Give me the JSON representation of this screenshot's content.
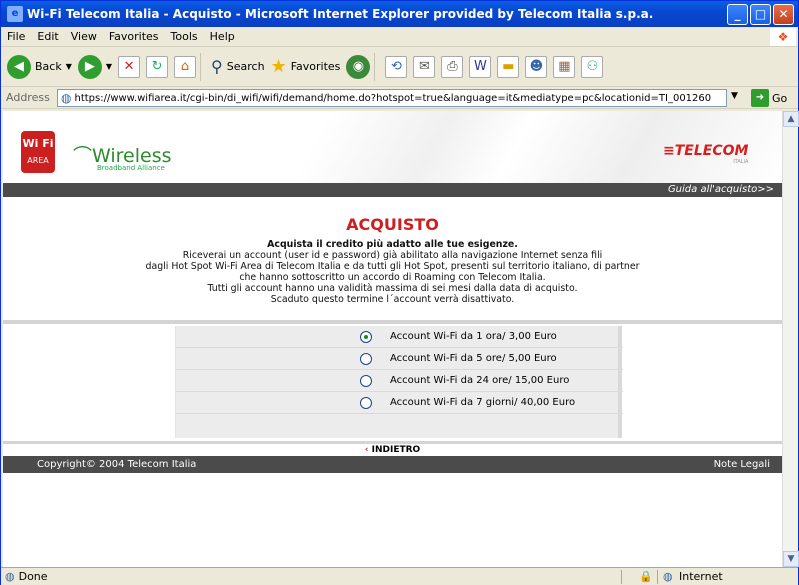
{
  "window": {
    "title": "Wi-Fi Telecom Italia - Acquisto - Microsoft Internet Explorer provided by Telecom Italia s.p.a."
  },
  "menu": [
    "File",
    "Edit",
    "View",
    "Favorites",
    "Tools",
    "Help"
  ],
  "toolbar": {
    "back": "Back",
    "search": "Search",
    "favorites": "Favorites"
  },
  "address": {
    "label": "Address",
    "url": "https://www.wifiarea.it/cgi-bin/di_wifi/wifi/demand/home.do?hotspot=true&language=it&mediatype=pc&locationid=TI_001260",
    "go": "Go"
  },
  "page": {
    "logo_wifi": "Wi Fi",
    "logo_area": "AREA",
    "wireless": "Wireless",
    "wireless_sub": "Broadband Alliance",
    "telecom": "TELECOM",
    "telecom_sub": "ITALIA",
    "guide_link": "Guida all'acquisto>>",
    "title": "ACQUISTO",
    "headline": "Acquista il credito più adatto alle tue esigenze.",
    "lines": [
      "Riceverai un account (user id e password) già abilitato alla navigazione Internet senza fili",
      "dagli Hot Spot Wi-Fi Area di Telecom Italia e da tutti gli Hot Spot, presenti sul territorio italiano, di partner",
      "che hanno sottoscritto un accordo di Roaming con Telecom Italia.",
      "Tutti gli account hanno una validità massima di sei mesi dalla data di acquisto.",
      "Scaduto questo termine l´account verrà disattivato."
    ],
    "options": [
      {
        "label": "Account Wi-Fi da 1 ora/ 3,00 Euro",
        "selected": true
      },
      {
        "label": "Account Wi-Fi da 5 ore/ 5,00 Euro",
        "selected": false
      },
      {
        "label": "Account Wi-Fi da 24 ore/ 15,00 Euro",
        "selected": false
      },
      {
        "label": "Account Wi-Fi da 7 giorni/ 40,00 Euro",
        "selected": false
      }
    ],
    "back": "INDIETRO",
    "copyright": "Copyright© 2004 Telecom Italia",
    "legal": "Note Legali"
  },
  "status": {
    "text": "Done",
    "zone": "Internet"
  }
}
